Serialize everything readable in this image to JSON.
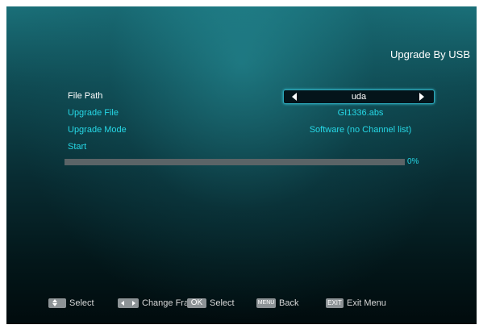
{
  "screen": {
    "title": "Upgrade By USB"
  },
  "menu": {
    "file_path": {
      "label": "File Path",
      "value": "uda"
    },
    "upgrade_file": {
      "label": "Upgrade File",
      "value": "GI1336.abs"
    },
    "upgrade_mode": {
      "label": "Upgrade Mode",
      "value": "Software (no Channel list)"
    },
    "start": {
      "label": "Start"
    }
  },
  "progress": {
    "value": 0,
    "label": "0%"
  },
  "footer": {
    "select": "Select",
    "change_frame": "Change Fram",
    "ok_key": "OK",
    "ok_select": "Select",
    "menu_key": "MENU",
    "back": "Back",
    "exit_key": "EXIT",
    "exit_menu": "Exit Menu"
  },
  "colors": {
    "accent": "#26d8e6",
    "active_text": "#ffffff",
    "key_bg": "#8d9396"
  },
  "icons": {
    "up_down": "up-down-arrows-icon",
    "left_right": "left-right-arrows-icon",
    "selector_left": "left-arrow-icon",
    "selector_right": "right-arrow-icon"
  }
}
